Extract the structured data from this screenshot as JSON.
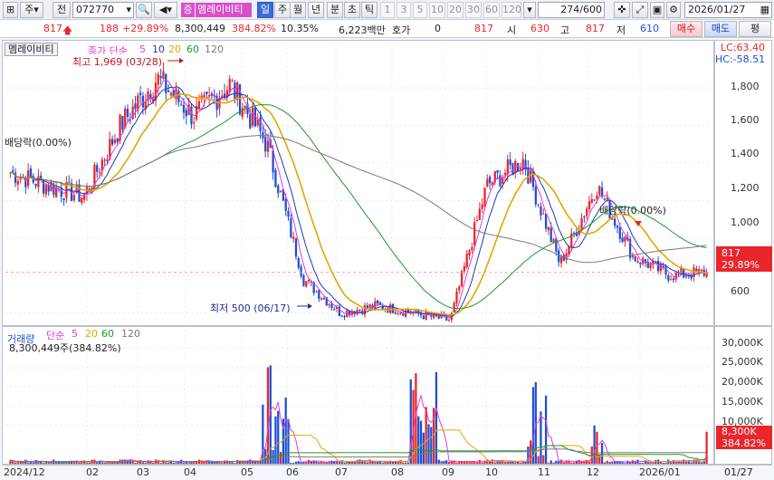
{
  "toolbar": {
    "type_select": "주",
    "prev_label": "전",
    "code": "072770",
    "stock_badge": "증",
    "stock_name": "멤레이비티",
    "periods": [
      "일",
      "주",
      "월",
      "년",
      "분",
      "초",
      "틱"
    ],
    "active_period": "일",
    "minutes": [
      "1",
      "3",
      "5",
      "10",
      "20",
      "30",
      "60",
      "120"
    ],
    "count_value": "274",
    "count_total": "/600",
    "date_value": "2026/01/27"
  },
  "quote": {
    "price": "817",
    "change": "188",
    "change_pct": "+29.89%",
    "volume": "8,300,449",
    "volume_ratio": "384.82%",
    "turnover": "10.35%",
    "amount": "6,223백만",
    "hoga_label": "호가",
    "hoga_value": "0",
    "price2": "817",
    "open_label": "시",
    "open": "630",
    "high_label": "고",
    "high": "817",
    "low_label": "저",
    "low": "610",
    "buy_label": "매수",
    "sell_label": "매도",
    "eval_label": "평"
  },
  "main_legend": {
    "name": "멤레이비티",
    "ma_label": "종가 단순",
    "ma_periods": [
      "5",
      "10",
      "20",
      "60",
      "120"
    ],
    "lc": "LC:63.40",
    "hc": "HC:-58.51"
  },
  "annotations": {
    "high": "최고 1,969 (03/28)",
    "low": "최저 500 (06/17)",
    "div_left": "배당락(0.00%)",
    "div_right": "배당락(0.00%)"
  },
  "price_axis": [
    "1,800",
    "1,600",
    "1,400",
    "1,200",
    "1,000",
    "800",
    "600"
  ],
  "price_box": {
    "value": "817",
    "pct": "29.89%"
  },
  "volume_legend": {
    "name": "거래량",
    "ma_label": "단순",
    "ma_periods": [
      "5",
      "20",
      "60",
      "120"
    ],
    "value": "8,300,449주(384.82%)"
  },
  "volume_axis": [
    "30,000K",
    "25,000K",
    "20,000K",
    "15,000K",
    "10,000K"
  ],
  "volume_box": {
    "value": "8,300K",
    "pct": "384.82%"
  },
  "x_axis": [
    "2024/12",
    "02",
    "03",
    "04",
    "05",
    "06",
    "07",
    "08",
    "09",
    "10",
    "11",
    "12",
    "2026/01"
  ],
  "x_axis_right": "01/27",
  "colors": {
    "up": "#e8262b",
    "down": "#1c4fd8",
    "ma5": "#e83ad0",
    "ma10": "#1e3cb0",
    "ma20": "#e8a400",
    "ma60": "#1c9a2a",
    "ma120": "#7a7a7a"
  },
  "chart_data": {
    "type": "line",
    "price_series": [
      {
        "x": "2024/12",
        "close": 1350
      },
      {
        "x": "2025/01",
        "close": 1280
      },
      {
        "x": "2025/02",
        "close": 1220
      },
      {
        "x": "2025/03",
        "close": 1600
      },
      {
        "x": "2025/03/28",
        "close": 1850
      },
      {
        "x": "2025/04",
        "close": 1650
      },
      {
        "x": "2025/05",
        "close": 1820
      },
      {
        "x": "2025/05/15",
        "close": 1500
      },
      {
        "x": "2025/06",
        "close": 780
      },
      {
        "x": "2025/06/17",
        "close": 600
      },
      {
        "x": "2025/07",
        "close": 640
      },
      {
        "x": "2025/08",
        "close": 600
      },
      {
        "x": "2025/08/20",
        "close": 560
      },
      {
        "x": "2025/09",
        "close": 1280
      },
      {
        "x": "2025/09/10",
        "close": 1420
      },
      {
        "x": "2025/10",
        "close": 860
      },
      {
        "x": "2025/11",
        "close": 1280
      },
      {
        "x": "2025/12",
        "close": 900
      },
      {
        "x": "2026/01",
        "close": 800
      },
      {
        "x": "2026/01/27",
        "close": 817
      }
    ],
    "ylim": [
      550,
      1950
    ],
    "volume_ylim": [
      0,
      33000
    ]
  }
}
